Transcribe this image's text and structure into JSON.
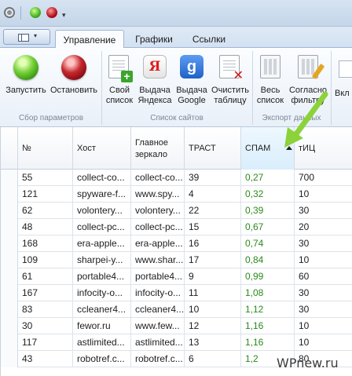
{
  "tabs": [
    {
      "label": "Управление",
      "active": true
    },
    {
      "label": "Графики",
      "active": false
    },
    {
      "label": "Ссылки",
      "active": false
    }
  ],
  "ribbon": {
    "start": {
      "label": "Запустить",
      "icon": "green-circle-icon"
    },
    "stop": {
      "label": "Остановить",
      "icon": "red-circle-icon"
    },
    "own_list": {
      "label_line1": "Свой",
      "label_line2": "список",
      "icon": "add-document-icon"
    },
    "yandex": {
      "label_line1": "Выдача",
      "label_line2": "Яндекса",
      "icon_glyph": "Я"
    },
    "google": {
      "label_line1": "Выдача",
      "label_line2": "Google",
      "icon_glyph": "g"
    },
    "clear": {
      "label_line1": "Очистить",
      "label_line2": "таблицу",
      "icon": "clear-table-icon"
    },
    "all_list": {
      "label_line1": "Весь",
      "label_line2": "список",
      "icon": "calculator-icon"
    },
    "filter": {
      "label_line1": "Согласно",
      "label_line2": "фильтру",
      "icon": "filter-edit-icon"
    },
    "cut_label": "Вкл",
    "groups": {
      "params": "Сбор параметров",
      "sites": "Список сайтов",
      "export": "Экспорт данных"
    }
  },
  "table": {
    "columns": [
      {
        "key": "num",
        "label": "№",
        "label2": ""
      },
      {
        "key": "host",
        "label": "Хост",
        "label2": ""
      },
      {
        "key": "mirror",
        "label": "Главное",
        "label2": "зеркало"
      },
      {
        "key": "trust",
        "label": "ТРАСТ",
        "label2": ""
      },
      {
        "key": "spam",
        "label": "СПАМ",
        "label2": "",
        "sorted": "asc"
      },
      {
        "key": "tic",
        "label": "тИЦ",
        "label2": ""
      }
    ],
    "rows": [
      {
        "num": "55",
        "host": "collect-co...",
        "mirror": "collect-co...",
        "trust": "39",
        "spam": "0,27",
        "tic": "700"
      },
      {
        "num": "121",
        "host": "spyware-f...",
        "mirror": "www.spy...",
        "trust": "4",
        "spam": "0,32",
        "tic": "10"
      },
      {
        "num": "62",
        "host": "volontery...",
        "mirror": "volontery...",
        "trust": "22",
        "spam": "0,39",
        "tic": "30"
      },
      {
        "num": "48",
        "host": "collect-pc...",
        "mirror": "collect-pc...",
        "trust": "15",
        "spam": "0,67",
        "tic": "20"
      },
      {
        "num": "168",
        "host": "era-apple...",
        "mirror": "era-apple...",
        "trust": "16",
        "spam": "0,74",
        "tic": "30"
      },
      {
        "num": "109",
        "host": "sharpei-y...",
        "mirror": "www.shar...",
        "trust": "17",
        "spam": "0,84",
        "tic": "10"
      },
      {
        "num": "61",
        "host": "portable4...",
        "mirror": "portable4...",
        "trust": "9",
        "spam": "0,99",
        "tic": "60"
      },
      {
        "num": "167",
        "host": "infocity-o...",
        "mirror": "infocity-o...",
        "trust": "11",
        "spam": "1,08",
        "tic": "30"
      },
      {
        "num": "83",
        "host": "ccleaner4...",
        "mirror": "ccleaner4...",
        "trust": "10",
        "spam": "1,12",
        "tic": "30"
      },
      {
        "num": "30",
        "host": "fewor.ru",
        "mirror": "www.few...",
        "trust": "12",
        "spam": "1,16",
        "tic": "10"
      },
      {
        "num": "117",
        "host": "astlimited...",
        "mirror": "astlimited...",
        "trust": "13",
        "spam": "1,16",
        "tic": "10"
      },
      {
        "num": "43",
        "host": "robotref.c...",
        "mirror": "robotref.c...",
        "trust": "6",
        "spam": "1,2",
        "tic": "80"
      }
    ]
  },
  "watermark": "WPnew.ru",
  "colors": {
    "spam_text": "#2a8a1c",
    "annotation_arrow": "#8cd23a",
    "ribbon_bg": "#eef4fb"
  }
}
